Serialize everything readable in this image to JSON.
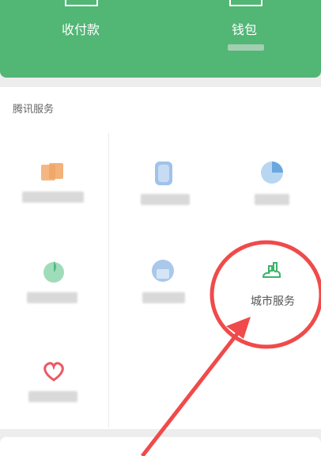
{
  "wallet_header": {
    "receive_pay_label": "收付款",
    "wallet_label": "钱包"
  },
  "tencent_services": {
    "title": "腾讯服务",
    "city_service_label": "城市服务"
  },
  "colors": {
    "header_green": "#52b675",
    "annotation_red": "#f04a4a",
    "city_icon_green": "#3db36a"
  },
  "icons": {
    "city_service": "city-building-icon",
    "heart": "heart-icon"
  }
}
